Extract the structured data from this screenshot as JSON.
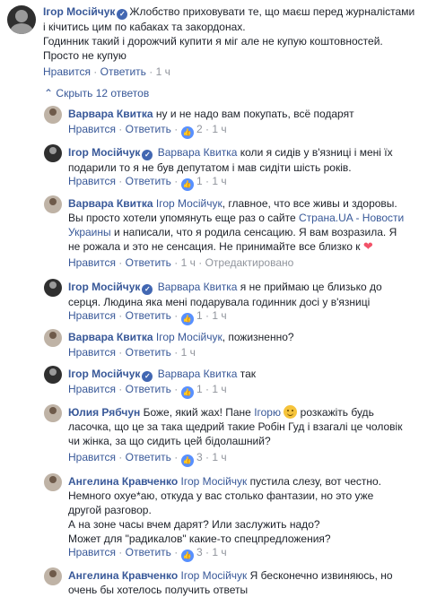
{
  "top_comment": {
    "author": "Ігор Мосійчук",
    "verified_icon": "verified-badge-icon",
    "lines": [
      "Жлобство приховувати те, що маєш перед журналістами",
      "і кічитись цим по кабаках та закордонах.",
      "Годинник такий і дорожчий купити я міг але не купую коштовностей.",
      "Просто не купую"
    ],
    "like_label": "Нравится",
    "reply_label": "Ответить",
    "time": "1 ч"
  },
  "hide_replies": {
    "icon": "chevron-up-icon",
    "label": "Скрыть 12 ответов"
  },
  "replies": [
    {
      "author": "Варвара Квитка",
      "verified": false,
      "lines": [
        "ну и не надо вам покупать, всё подарят"
      ],
      "like_label": "Нравится",
      "reply_label": "Ответить",
      "likes": "2",
      "time": "1 ч",
      "edited": ""
    },
    {
      "author": "Ігор Мосійчук",
      "verified": true,
      "mention": "Варвара Квитка",
      "lines": [
        "коли я сидів у в'язниці і мені їх",
        "подарили то я не був депутатом і мав сидіти шість років."
      ],
      "like_label": "Нравится",
      "reply_label": "Ответить",
      "likes": "1",
      "time": "1 ч",
      "edited": ""
    },
    {
      "author": "Варвара Квитка",
      "verified": false,
      "mention": "Ігор Мосійчук",
      "lines_before_link": ", главное, что все живы и здоровы.",
      "line2_prefix": "Вы просто хотели упомянуть еще раз о сайте ",
      "link_text": "Страна.UA - Новости",
      "link_text_2": "Украины",
      "line3_suffix": " и написали, что я родила сенсацию. Я вам возразила. Я",
      "line4": "не рожала и это не сенсация. Не принимайте все близко к",
      "heart": "❤",
      "like_label": "Нравится",
      "reply_label": "Ответить",
      "time": "1 ч",
      "edited": "Отредактировано"
    },
    {
      "author": "Ігор Мосійчук",
      "verified": true,
      "mention": "Варвара Квитка",
      "lines": [
        "я не приймаю це близько до",
        "серця. Людина яка мені подарувала годинник досі у в'язниці"
      ],
      "like_label": "Нравится",
      "reply_label": "Ответить",
      "likes": "1",
      "time": "1 ч",
      "edited": ""
    },
    {
      "author": "Варвара Квитка",
      "verified": false,
      "mention": "Ігор Мосійчук",
      "lines": [
        ", пожизненно?"
      ],
      "like_label": "Нравится",
      "reply_label": "Ответить",
      "time": "1 ч",
      "edited": ""
    },
    {
      "author": "Ігор Мосійчук",
      "verified": true,
      "mention": "Варвара Квитка",
      "lines": [
        "так"
      ],
      "like_label": "Нравится",
      "reply_label": "Ответить",
      "likes": "1",
      "time": "1 ч",
      "edited": ""
    },
    {
      "author": "Юлия Рябчун",
      "verified": false,
      "line1_before_tag": "Боже, який жах! Пане ",
      "tag": "Ігорю",
      "line1_after_emoji": "розкажіть будь",
      "lines": [
        "ласочка, що це за така щедрий такие Робін Гуд і взагалі це чоловік",
        "чи жінка, за що сидить цей бідолашний?"
      ],
      "like_label": "Нравится",
      "reply_label": "Ответить",
      "likes": "3",
      "time": "1 ч",
      "edited": ""
    },
    {
      "author": "Ангелина Кравченко",
      "verified": false,
      "mention": "Ігор Мосійчук",
      "lines": [
        "пустила слезу, вот честно.",
        "Немного охуе*аю, откуда у вас столько фантазии, но это уже",
        "другой разговор.",
        "А на зоне часы вчем дарят? Или заслужить надо?",
        "Может для \"радикалов\" какие-то спецпредложения?"
      ],
      "like_label": "Нравится",
      "reply_label": "Ответить",
      "likes": "3",
      "time": "1 ч",
      "edited": ""
    },
    {
      "author": "Ангелина Кравченко",
      "verified": false,
      "mention": "Ігор Мосійчук",
      "lines": [
        "Я бесконечно извиняюсь, но",
        "очень бы хотелось получить ответы"
      ]
    }
  ],
  "sep": "·",
  "like_icon": "thumbs-up-icon",
  "colors": {
    "link": "#385898",
    "meta": "#90949c",
    "text": "#1d2129",
    "like_badge": "#5890ff"
  }
}
